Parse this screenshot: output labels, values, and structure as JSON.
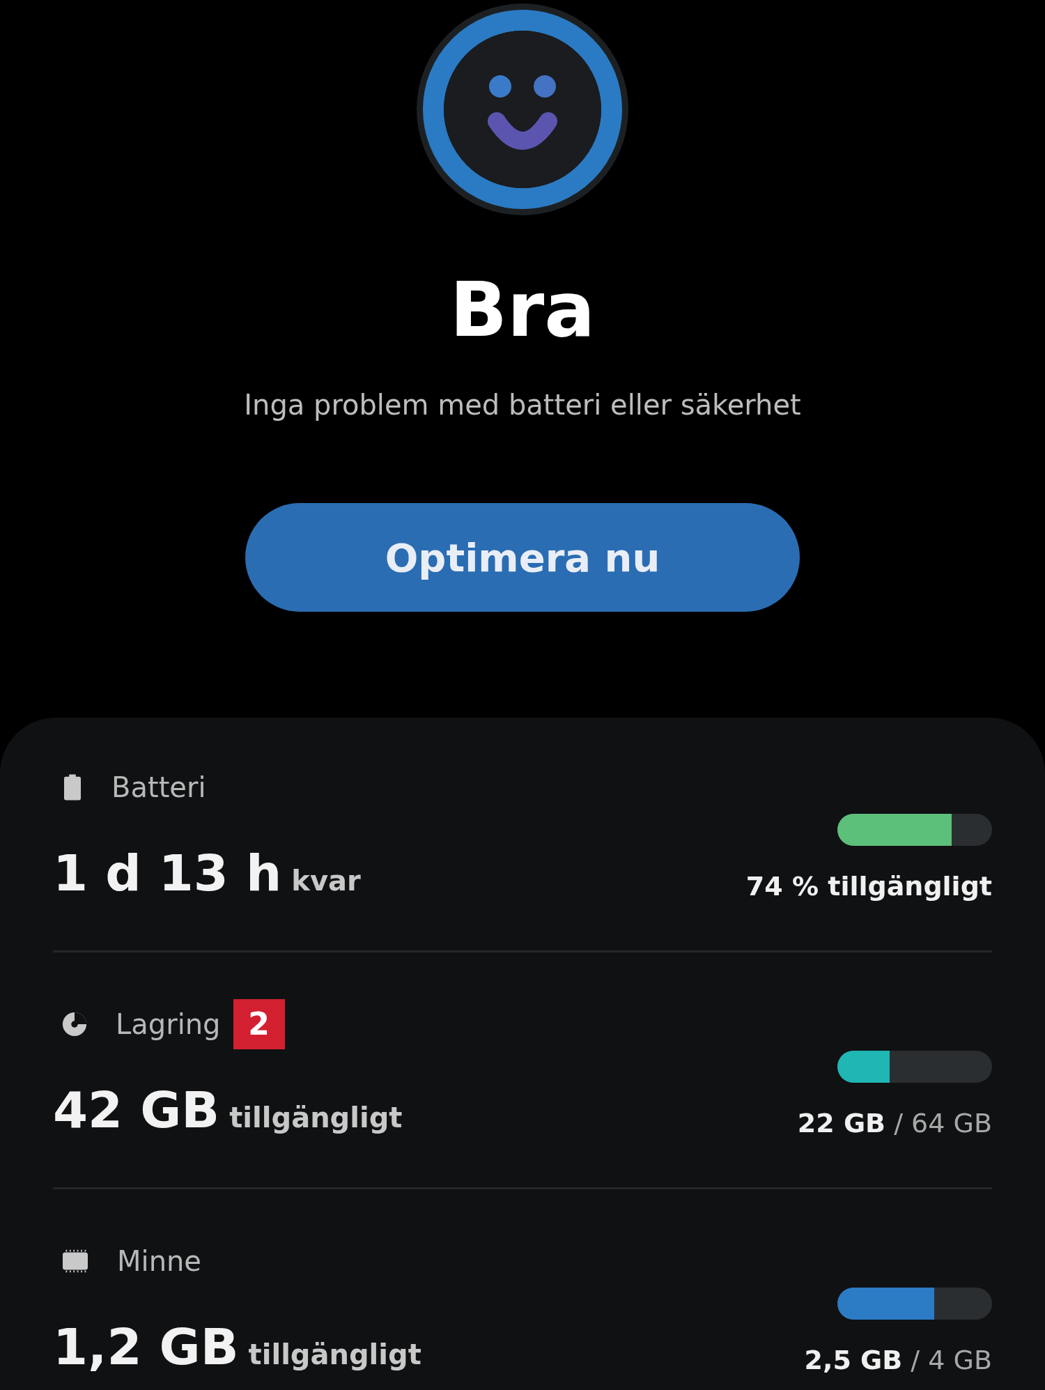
{
  "status": {
    "title": "Bra",
    "subtitle": "Inga problem med batteri eller säkerhet"
  },
  "action_button": {
    "label": "Optimera nu"
  },
  "items": [
    {
      "kind": "battery",
      "label": "Batteri",
      "value": "1 d 13 h",
      "unit": "kvar",
      "level": 0.74,
      "color": "#5cbf7a",
      "reading": "**74 % tillgängligt**"
    },
    {
      "kind": "storage",
      "label": "Lagring",
      "badge": "2",
      "value": "42 GB",
      "unit": "tillgängligt",
      "level": 0.34,
      "color": "#1fb6b4",
      "reading": "**22 GB** / 64 GB"
    },
    {
      "kind": "memory",
      "label": "Minne",
      "value": "1,2 GB",
      "unit": "tillgängligt",
      "level": 0.625,
      "color": "#2b7cc4",
      "reading": "**2,5 GB** / 4 GB"
    }
  ]
}
